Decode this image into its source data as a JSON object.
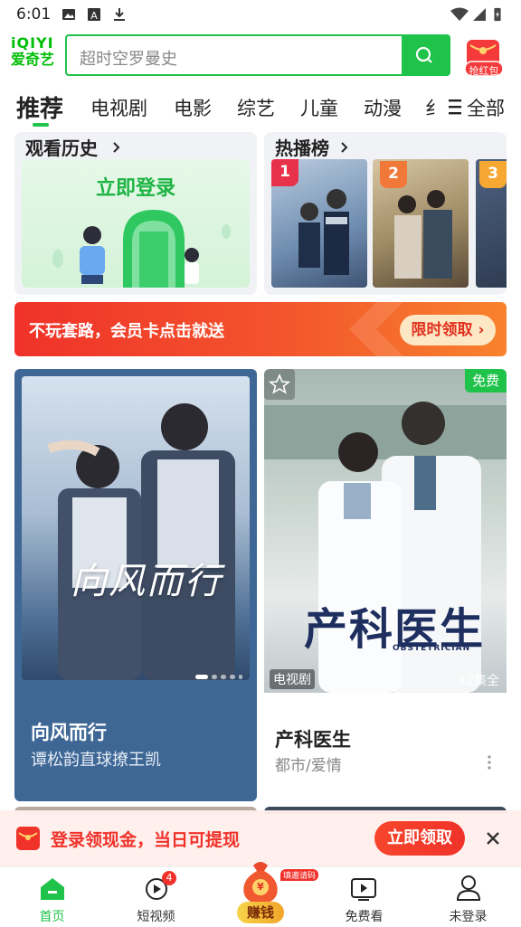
{
  "status_bar": {
    "time": "6:01"
  },
  "header": {
    "logo_line1": "iQIYI",
    "logo_line2": "爱奇艺",
    "search_placeholder": "超时空罗曼史",
    "red_packet_label": "抢红包"
  },
  "tabs": {
    "items": [
      "推荐",
      "电视剧",
      "电影",
      "综艺",
      "儿童",
      "动漫",
      "纟"
    ],
    "all_label": "全部",
    "active": "推荐"
  },
  "history_card": {
    "title": "观看历史",
    "login_text": "立即登录"
  },
  "hot_card": {
    "title": "热播榜",
    "ranks": [
      "1",
      "2",
      "3"
    ],
    "rank_colors": [
      "#e8324c",
      "#f0793a",
      "#f6a832"
    ]
  },
  "promo_banner": {
    "text": "不玩套路，会员卡点击就送",
    "cta": "限时领取"
  },
  "feed": [
    {
      "poster_title": "向风而行",
      "title": "向风而行",
      "subtitle": "谭松韵直球撩王凯"
    },
    {
      "poster_title": "产科医生",
      "poster_sub": "OBSTETRICIAN",
      "badge": "免费",
      "category_tag": "电视剧",
      "episodes": "42集全",
      "title": "产科医生",
      "subtitle": "都市/爱情"
    }
  ],
  "bottom_tip": {
    "text": "登录领现金，当日可提现",
    "cta": "立即领取"
  },
  "nav": {
    "items": [
      "首页",
      "短视频",
      "赚钱",
      "免费看",
      "未登录"
    ],
    "short_video_badge": "4",
    "earn_badge": "填邀请码",
    "earn_icon_char": "¥"
  },
  "colors": {
    "brand_green": "#1fc34a",
    "promo_red": "#f0322a"
  }
}
